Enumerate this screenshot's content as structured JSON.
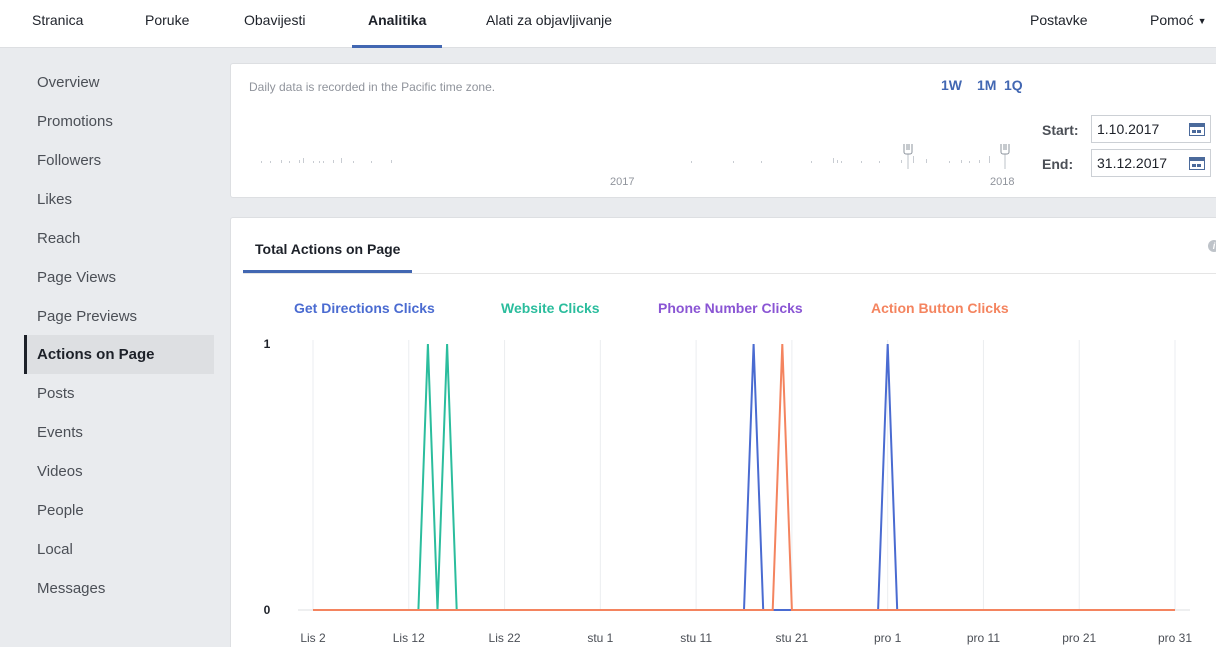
{
  "topnav": {
    "tabs": [
      {
        "label": "Stranica",
        "active": false
      },
      {
        "label": "Poruke",
        "active": false
      },
      {
        "label": "Obavijesti",
        "active": false
      },
      {
        "label": "Analitika",
        "active": true
      },
      {
        "label": "Alati za objavljivanje",
        "active": false
      }
    ],
    "right": [
      {
        "label": "Postavke"
      },
      {
        "label": "Pomoć"
      }
    ]
  },
  "sidebar": {
    "items": [
      {
        "label": "Overview",
        "active": false
      },
      {
        "label": "Promotions",
        "active": false
      },
      {
        "label": "Followers",
        "active": false
      },
      {
        "label": "Likes",
        "active": false
      },
      {
        "label": "Reach",
        "active": false
      },
      {
        "label": "Page Views",
        "active": false
      },
      {
        "label": "Page Previews",
        "active": false
      },
      {
        "label": "Actions on Page",
        "active": true
      },
      {
        "label": "Posts",
        "active": false
      },
      {
        "label": "Events",
        "active": false
      },
      {
        "label": "Videos",
        "active": false
      },
      {
        "label": "People",
        "active": false
      },
      {
        "label": "Local",
        "active": false
      },
      {
        "label": "Messages",
        "active": false
      }
    ]
  },
  "range": {
    "note": "Daily data is recorded in the Pacific time zone.",
    "quick": [
      "1W",
      "1M",
      "1Q"
    ],
    "years": [
      "2017",
      "2018"
    ],
    "start_label": "Start:",
    "start_value": "1.10.2017",
    "end_label": "End:",
    "end_value": "31.12.2017"
  },
  "chart_panel": {
    "tab": "Total Actions on Page",
    "info": "i"
  },
  "colors": {
    "accent": "#4267b2",
    "get_directions": "#4a6bd1",
    "website": "#2bbd9d",
    "phone": "#8a55d4",
    "action_button": "#f4845f"
  },
  "chart_data": {
    "type": "line",
    "title": "",
    "xlabel": "",
    "ylabel": "",
    "ylim": [
      0,
      1
    ],
    "yticks": [
      "1",
      "0"
    ],
    "xticks": [
      "Lis 2",
      "Lis 12",
      "Lis 22",
      "stu 1",
      "stu 11",
      "stu 21",
      "pro 1",
      "pro 11",
      "pro 21",
      "pro 31"
    ],
    "x_domain": [
      1,
      91
    ],
    "grid": true,
    "legend_position": "top",
    "series": [
      {
        "name": "Get Directions Clicks",
        "color": "#4a6bd1",
        "values": [
          [
            1,
            0
          ],
          [
            46,
            0
          ],
          [
            47,
            1
          ],
          [
            48,
            0
          ],
          [
            60,
            0
          ],
          [
            61,
            1
          ],
          [
            62,
            0
          ],
          [
            91,
            0
          ]
        ]
      },
      {
        "name": "Website Clicks",
        "color": "#2bbd9d",
        "values": [
          [
            1,
            0
          ],
          [
            12,
            0
          ],
          [
            13,
            1
          ],
          [
            14,
            0
          ],
          [
            15,
            1
          ],
          [
            16,
            0
          ],
          [
            91,
            0
          ]
        ]
      },
      {
        "name": "Phone Number Clicks",
        "color": "#8a55d4",
        "values": [
          [
            1,
            0
          ],
          [
            91,
            0
          ]
        ]
      },
      {
        "name": "Action Button Clicks",
        "color": "#f4845f",
        "values": [
          [
            1,
            0
          ],
          [
            49,
            0
          ],
          [
            50,
            1
          ],
          [
            51,
            0
          ],
          [
            91,
            0
          ]
        ]
      }
    ]
  }
}
